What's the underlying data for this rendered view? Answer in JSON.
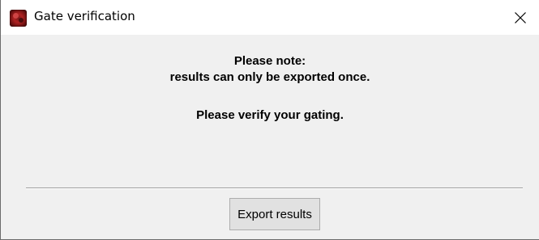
{
  "window": {
    "title": "Gate verification",
    "icon": "app-icon",
    "close_icon": "close-icon"
  },
  "message": {
    "line1": "Please note:",
    "line2": "results can only be exported once.",
    "line3": "Please verify your gating."
  },
  "buttons": {
    "export_label": "Export results"
  }
}
